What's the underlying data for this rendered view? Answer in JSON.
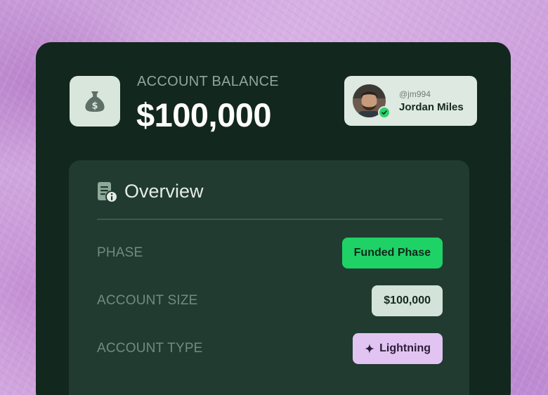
{
  "balance": {
    "label": "ACCOUNT BALANCE",
    "value": "$100,000",
    "icon": "money-bag-icon"
  },
  "user": {
    "handle": "@jm994",
    "name": "Jordan Miles",
    "verified": true
  },
  "overview": {
    "title": "Overview",
    "icon": "document-info-icon",
    "rows": [
      {
        "label": "PHASE",
        "value": "Funded Phase"
      },
      {
        "label": "ACCOUNT SIZE",
        "value": "$100,000"
      },
      {
        "label": "ACCOUNT TYPE",
        "value": "Lightning",
        "icon": "sparkle-icon"
      }
    ]
  },
  "colors": {
    "card": "#12271e",
    "panel": "#213b30",
    "funded": "#1fd266",
    "lightning": "#e2c4f2"
  }
}
